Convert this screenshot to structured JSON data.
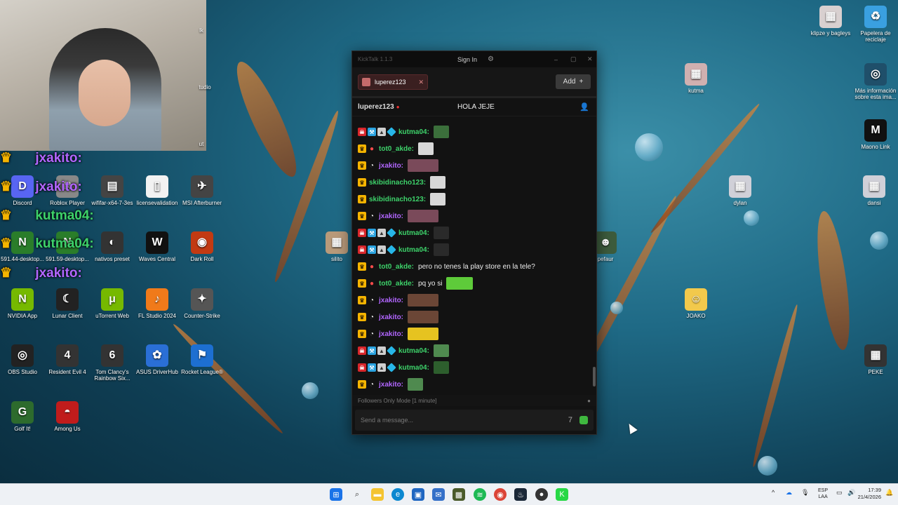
{
  "desktop": {
    "icons_left": [
      {
        "label": "Discord",
        "color": "#5865f2",
        "glyph": "D"
      },
      {
        "label": "Roblox Player",
        "color": "#888888",
        "glyph": "R"
      },
      {
        "label": "wififar-x64-7-3es",
        "color": "#444444",
        "glyph": "▤"
      },
      {
        "label": "licensevalidation",
        "color": "#f2f2f2",
        "glyph": "▯"
      },
      {
        "label": "MSI Afterburner",
        "color": "#444444",
        "glyph": "✈"
      },
      {
        "label": "591.44-desktop...",
        "color": "#2a7d2a",
        "glyph": "N"
      },
      {
        "label": "591.59-desktop...",
        "color": "#2a7d2a",
        "glyph": "N"
      },
      {
        "label": "nativos preset",
        "color": "#333333",
        "glyph": "◐"
      },
      {
        "label": "Waves Central",
        "color": "#111111",
        "glyph": "W"
      },
      {
        "label": "Dark Roll",
        "color": "#c23a12",
        "glyph": "◉"
      },
      {
        "label": "NVIDIA App",
        "color": "#76b900",
        "glyph": "N"
      },
      {
        "label": "Lunar Client",
        "color": "#222222",
        "glyph": "☾"
      },
      {
        "label": "uTorrent Web",
        "color": "#76b900",
        "glyph": "μ"
      },
      {
        "label": "FL Studio 2024",
        "color": "#f07a1a",
        "glyph": "♪"
      },
      {
        "label": "Counter-Strike",
        "color": "#555555",
        "glyph": "✦"
      },
      {
        "label": "OBS Studio",
        "color": "#222222",
        "glyph": "◎"
      },
      {
        "label": "Resident Evil 4",
        "color": "#333333",
        "glyph": "4"
      },
      {
        "label": "Tom Clancy's Rainbow Six...",
        "color": "#333333",
        "glyph": "6"
      },
      {
        "label": "ASUS DriverHub",
        "color": "#2a6fd6",
        "glyph": "✿"
      },
      {
        "label": "Rocket League®",
        "color": "#1d6fd1",
        "glyph": "⚑"
      },
      {
        "label": "Golf It!",
        "color": "#2d6b2d",
        "glyph": "G"
      },
      {
        "label": "Among Us",
        "color": "#c01c1c",
        "glyph": "◓"
      }
    ],
    "icons_middle": [
      {
        "label": "silito",
        "color": "#b89a7a",
        "glyph": "▦"
      },
      {
        "label": "pefaur",
        "color": "#3d5c3d",
        "glyph": "☻"
      }
    ],
    "icons_right": [
      {
        "label": "klipze y bagleys",
        "color": "#d8d0d0",
        "glyph": "▦"
      },
      {
        "label": "Papelera de reciclaje",
        "color": "#3aa0e0",
        "glyph": "♻"
      },
      {
        "label": "kutma",
        "color": "#d0b0b0",
        "glyph": "▦"
      },
      {
        "label": "Más información sobre esta ima...",
        "color": "#1f4f6a",
        "glyph": "◎"
      },
      {
        "label": "Maono Link",
        "color": "#111111",
        "glyph": "M"
      },
      {
        "label": "dylan",
        "color": "#d0d0d8",
        "glyph": "▦"
      },
      {
        "label": "dansi",
        "color": "#d0d0d8",
        "glyph": "▦"
      },
      {
        "label": "JOAKO",
        "color": "#f2c94c",
        "glyph": "☺"
      },
      {
        "label": "PEKE",
        "color": "#333333",
        "glyph": "▦"
      }
    ],
    "partial_labels": [
      "lk",
      "tudio",
      "ut"
    ]
  },
  "overlay": [
    {
      "user": "jxakito:",
      "color": "#b266ff"
    },
    {
      "user": "jxakito:",
      "color": "#b266ff"
    },
    {
      "user": "kutma04:",
      "color": "#3dd26a"
    },
    {
      "user": "kutma04:",
      "color": "#3dd26a"
    },
    {
      "user": "jxakito:",
      "color": "#b266ff"
    }
  ],
  "kicktalk": {
    "title": "KickTalk 1.1.3",
    "sign_in": "Sign In",
    "tab_label": "luperez123",
    "add_label": "Add",
    "channel_name": "luperez123",
    "stream_title": "HOLA JEJE",
    "messages": [
      {
        "badges": [
          "skull",
          "blue",
          "gray",
          "cube"
        ],
        "user": "kutma04:",
        "color": "#3dd26a",
        "text": "",
        "emote": "#3b6f3b"
      },
      {
        "badges": [
          "crown",
          "red"
        ],
        "user": "tot0_akde:",
        "color": "#3dd26a",
        "text": "",
        "emote": "#d8d8d8"
      },
      {
        "badges": [
          "crown",
          "glasses"
        ],
        "user": "jxakito:",
        "color": "#b266ff",
        "text": "",
        "emote": "#7a4a5a"
      },
      {
        "badges": [
          "crown"
        ],
        "user": "skibidinacho123:",
        "color": "#3dd26a",
        "text": "",
        "emote": "#d8d8d8"
      },
      {
        "badges": [
          "crown"
        ],
        "user": "skibidinacho123:",
        "color": "#3dd26a",
        "text": "",
        "emote": "#d8d8d8"
      },
      {
        "badges": [
          "crown",
          "glasses"
        ],
        "user": "jxakito:",
        "color": "#b266ff",
        "text": "",
        "emote": "#7a4a5a"
      },
      {
        "badges": [
          "skull",
          "blue",
          "gray",
          "cube"
        ],
        "user": "kutma04:",
        "color": "#3dd26a",
        "text": "",
        "emote": "#2a2a2a"
      },
      {
        "badges": [
          "skull",
          "blue",
          "gray",
          "cube"
        ],
        "user": "kutma04:",
        "color": "#3dd26a",
        "text": "",
        "emote": "#2a2a2a"
      },
      {
        "badges": [
          "crown",
          "red"
        ],
        "user": "tot0_akde:",
        "color": "#3dd26a",
        "text": "pero no tenes la play store en la tele?",
        "emote": ""
      },
      {
        "badges": [
          "crown",
          "red"
        ],
        "user": "tot0_akde:",
        "color": "#3dd26a",
        "text": "pq yo si",
        "emote": "#5ecb3a"
      },
      {
        "badges": [
          "crown",
          "glasses"
        ],
        "user": "jxakito:",
        "color": "#b266ff",
        "text": "",
        "emote": "#6b4636"
      },
      {
        "badges": [
          "crown",
          "glasses"
        ],
        "user": "jxakito:",
        "color": "#b266ff",
        "text": "",
        "emote": "#6b4636"
      },
      {
        "badges": [
          "crown",
          "glasses"
        ],
        "user": "jxakito:",
        "color": "#b266ff",
        "text": "",
        "emote": "#e6c320"
      },
      {
        "badges": [
          "skull",
          "blue",
          "gray",
          "cube"
        ],
        "user": "kutma04:",
        "color": "#3dd26a",
        "text": "",
        "emote": "#4f8a4f"
      },
      {
        "badges": [
          "skull",
          "blue",
          "gray",
          "cube"
        ],
        "user": "kutma04:",
        "color": "#3dd26a",
        "text": "",
        "emote": "#2d5e2d"
      },
      {
        "badges": [
          "crown",
          "glasses"
        ],
        "user": "jxakito:",
        "color": "#b266ff",
        "text": "",
        "emote": "#4f8a4f"
      }
    ],
    "mode_text": "Followers Only Mode [1 minute]",
    "input_placeholder": "Send a message..."
  },
  "taskbar": {
    "lang_line1": "ESP",
    "lang_line2": "LAA",
    "time": "17:39",
    "date": "21/4/2026"
  }
}
